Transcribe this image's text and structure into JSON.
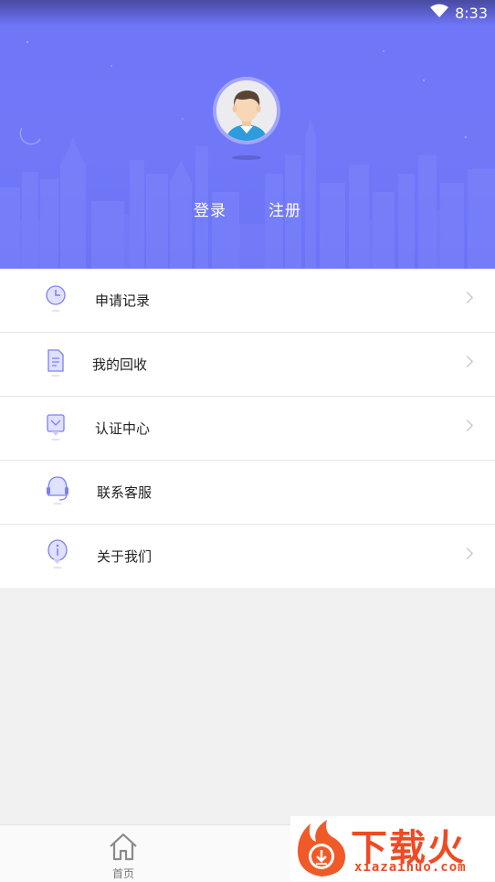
{
  "status_bar": {
    "time": "8:33",
    "wifi_icon": "wifi-icon"
  },
  "profile": {
    "avatar_icon": "user-avatar-icon",
    "login_label": "登录",
    "register_label": "注册"
  },
  "menu": {
    "items": [
      {
        "label": "申请记录",
        "icon": "clock-record-icon",
        "has_arrow": true
      },
      {
        "label": "我的回收",
        "icon": "document-icon",
        "has_arrow": true
      },
      {
        "label": "认证中心",
        "icon": "certificate-icon",
        "has_arrow": true
      },
      {
        "label": "联系客服",
        "icon": "headset-icon",
        "has_arrow": false
      },
      {
        "label": "关于我们",
        "icon": "info-icon",
        "has_arrow": true
      }
    ]
  },
  "bottom_nav": {
    "home_label": "首页",
    "home_icon": "home-icon"
  },
  "watermark": {
    "brand": "下载火",
    "domain": "xiazaihuo.com"
  },
  "colors": {
    "header": "#6f75f7",
    "accent": "#7b80f2",
    "watermark": "#f04a24"
  }
}
